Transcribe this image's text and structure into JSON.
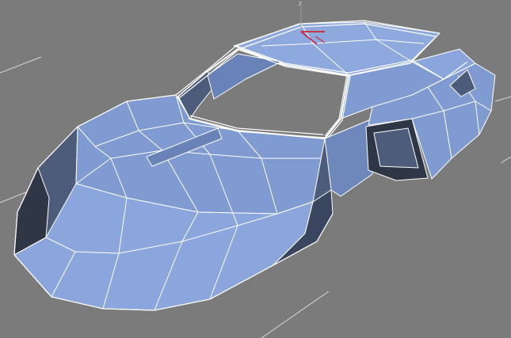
{
  "viewport": {
    "background": "#7b7b7b",
    "grid_color": "#d8d8d8",
    "wire_color": "#ffffff",
    "mesh_fill_light": "#8ea9dd",
    "mesh_fill_mid": "#7795cc",
    "mesh_fill_dark": "#4d5c7a",
    "mesh_fill_shadow": "#2f3747"
  },
  "gizmo": {
    "x_axis_color": "#e01010",
    "y_axis_color": "#d01040",
    "z_axis_label": "z"
  },
  "model": {
    "icon": "car-body-mesh-icon"
  }
}
